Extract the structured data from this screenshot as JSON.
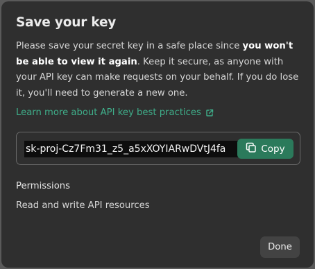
{
  "dialog": {
    "title": "Save your key",
    "description": {
      "part1": "Please save your secret key in a safe place since ",
      "bold": "you won't be able to view it again",
      "part2": ". Keep it secure, as anyone with your API key can make requests on your behalf. If you do lose it, you'll need to generate a new one."
    },
    "learn_more_label": "Learn more about API key best practices",
    "learn_more_icon": "external-link-icon",
    "secret_key_value": "sk-proj-Cz7Fm31_z5_a5xXOYIARwDVtJ4fa",
    "copy_label": "Copy",
    "copy_icon": "copy-icon",
    "permissions_heading": "Permissions",
    "permissions_value": "Read and write API resources",
    "done_label": "Done"
  },
  "colors": {
    "accent": "#3fae8a",
    "copy_button": "#2b7a5b",
    "dialog_bg": "#2f2f2f"
  }
}
